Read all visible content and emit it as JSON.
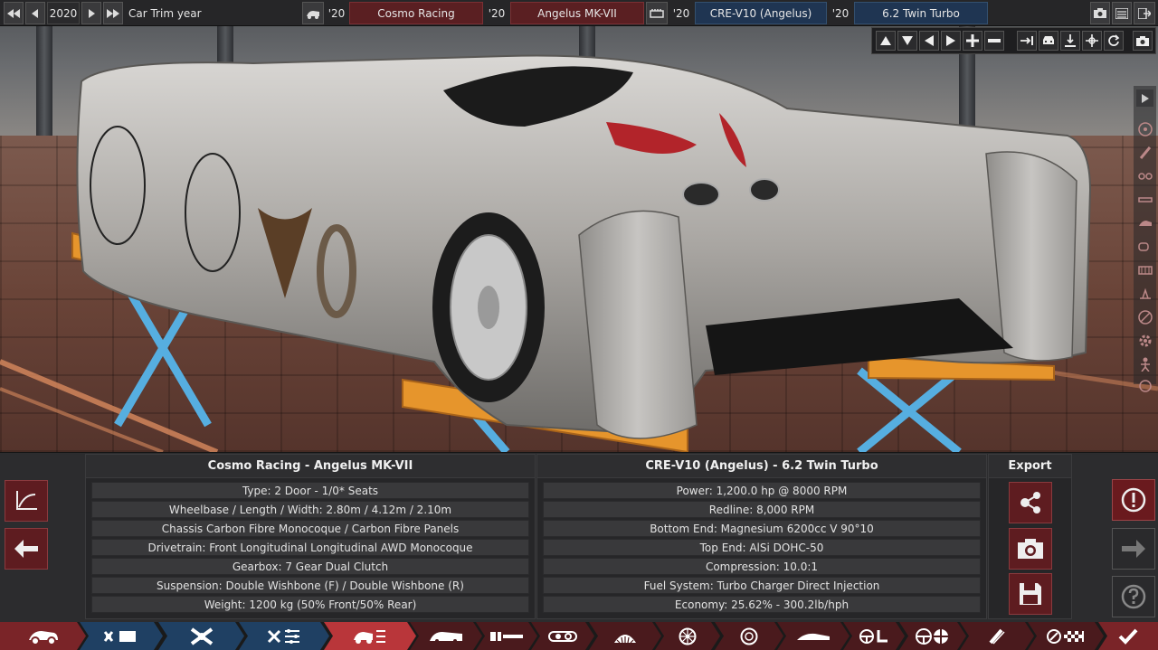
{
  "topbar": {
    "nav_first_icon": "skip-back-icon",
    "nav_prev_icon": "prev-icon",
    "year": "2020",
    "nav_next_icon": "next-icon",
    "nav_last_icon": "skip-forward-icon",
    "trim_label": "Car Trim year",
    "model_year_prefix": "'20",
    "model_family": "Cosmo Racing",
    "trim_year_prefix": "'20",
    "trim_name": "Angelus MK-VII",
    "engine_year_prefix": "'20",
    "engine_family": "CRE-V10 (Angelus)",
    "variant_year_prefix": "'20",
    "engine_variant": "6.2 Twin Turbo"
  },
  "car_info": {
    "heading": "Cosmo Racing - Angelus MK-VII",
    "rows": [
      "Type: 2 Door - 1/0* Seats",
      "Wheelbase / Length / Width: 2.80m / 4.12m / 2.10m",
      "Chassis Carbon Fibre Monocoque / Carbon Fibre Panels",
      "Drivetrain: Front Longitudinal Longitudinal AWD Monocoque",
      "Gearbox: 7 Gear Dual Clutch",
      "Suspension: Double Wishbone (F) / Double Wishbone (R)",
      "Weight: 1200 kg (50% Front/50% Rear)"
    ]
  },
  "engine_info": {
    "heading": "CRE-V10 (Angelus) - 6.2 Twin Turbo",
    "rows": [
      "Power: 1,200.0 hp @ 8000 RPM",
      "Redline:  8,000 RPM",
      "Bottom End: Magnesium 6200cc V 90°10",
      "Top End: AlSi DOHC-50",
      "Compression: 10.0:1",
      "Fuel System: Turbo Charger Direct Injection",
      "Economy: 25.62% - 300.2lb/hph"
    ]
  },
  "export": {
    "heading": "Export"
  },
  "colors": {
    "accent_red": "#b9363a",
    "tab_blue": "#1f4063",
    "tab_red": "#7a2428",
    "panel_bg": "#2c2c2e"
  },
  "tabs": [
    {
      "icon": "car-model-icon",
      "kind": "red"
    },
    {
      "icon": "engine-family-icon",
      "kind": "blue"
    },
    {
      "icon": "engine-block-icon",
      "kind": "blue"
    },
    {
      "icon": "engine-tune-icon",
      "kind": "blue"
    },
    {
      "icon": "car-trim-icon",
      "kind": "active"
    },
    {
      "icon": "body-icon",
      "kind": "dark"
    },
    {
      "icon": "chassis-icon",
      "kind": "dark"
    },
    {
      "icon": "fixtures-icon",
      "kind": "dark"
    },
    {
      "icon": "suspension-icon",
      "kind": "dark"
    },
    {
      "icon": "wheels-icon",
      "kind": "dark"
    },
    {
      "icon": "brakes-icon",
      "kind": "dark"
    },
    {
      "icon": "aero-icon",
      "kind": "dark"
    },
    {
      "icon": "interior-icon",
      "kind": "dark"
    },
    {
      "icon": "drivetrain-icon",
      "kind": "dark"
    },
    {
      "icon": "fuel-icon",
      "kind": "dark"
    },
    {
      "icon": "testing-icon",
      "kind": "dark"
    },
    {
      "icon": "confirm-icon",
      "kind": "red"
    }
  ]
}
